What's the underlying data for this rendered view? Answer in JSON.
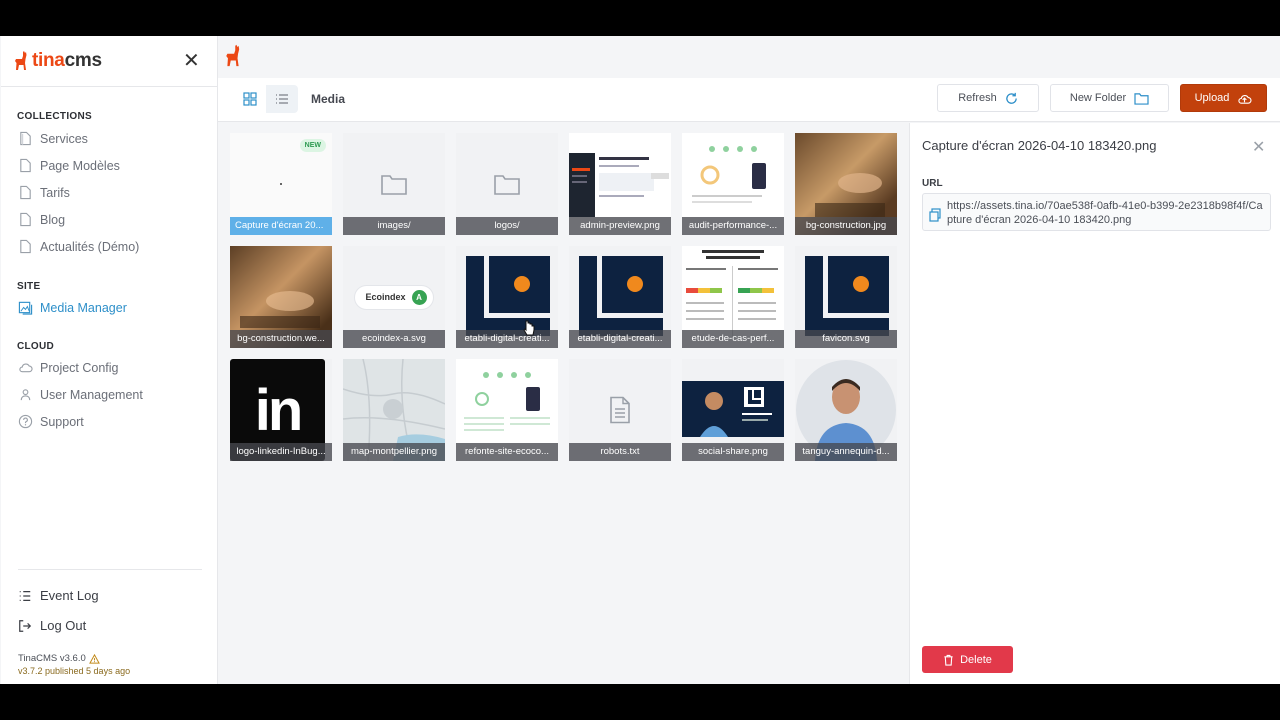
{
  "brand": {
    "name_part1": "tina",
    "name_part2": "cms"
  },
  "sidebar": {
    "collections_heading": "COLLECTIONS",
    "collections": [
      {
        "label": "Services"
      },
      {
        "label": "Page Modèles"
      },
      {
        "label": "Tarifs"
      },
      {
        "label": "Blog"
      },
      {
        "label": "Actualités (Démo)"
      }
    ],
    "site_heading": "SITE",
    "site_items": [
      {
        "label": "Media Manager"
      }
    ],
    "cloud_heading": "CLOUD",
    "cloud_items": [
      {
        "label": "Project Config"
      },
      {
        "label": "User Management"
      },
      {
        "label": "Support"
      }
    ],
    "event_log": "Event Log",
    "log_out": "Log Out",
    "version": "TinaCMS v3.6.0",
    "published": "v3.7.2 published 5 days ago"
  },
  "toolbar": {
    "title": "Media",
    "refresh": "Refresh",
    "new_folder": "New Folder",
    "upload": "Upload"
  },
  "media": {
    "new_badge": "NEW",
    "items": [
      {
        "name": "Capture d'écran 20..."
      },
      {
        "name": "images/"
      },
      {
        "name": "logos/"
      },
      {
        "name": "admin-preview.png"
      },
      {
        "name": "audit-performance-..."
      },
      {
        "name": "bg-construction.jpg"
      },
      {
        "name": "bg-construction.we..."
      },
      {
        "name": "ecoindex-a.svg"
      },
      {
        "name": "etabli-digital-creati..."
      },
      {
        "name": "etabli-digital-creati..."
      },
      {
        "name": "etude-de-cas-perf..."
      },
      {
        "name": "favicon.svg"
      },
      {
        "name": "logo-linkedin-InBug..."
      },
      {
        "name": "map-montpellier.png"
      },
      {
        "name": "refonte-site-ecoco..."
      },
      {
        "name": "robots.txt"
      },
      {
        "name": "social-share.png"
      },
      {
        "name": "tanguy-annequin-d..."
      }
    ],
    "ecoindex_text": "Ecoindex",
    "ecoindex_grade": "A",
    "linkedin_text": "in"
  },
  "detail": {
    "filename": "Capture d'écran 2026-04-10 183420.png",
    "url_label": "URL",
    "url": "https://assets.tina.io/70ae538f-0afb-41e0-b399-2e2318b98f4f/Capture d'écran 2026-04-10 183420.png",
    "delete": "Delete"
  },
  "colors": {
    "accent": "#ec4815",
    "upload": "#c2410c",
    "delete": "#e2394a",
    "link": "#2d8fc9",
    "selected": "#5fb0e8"
  }
}
